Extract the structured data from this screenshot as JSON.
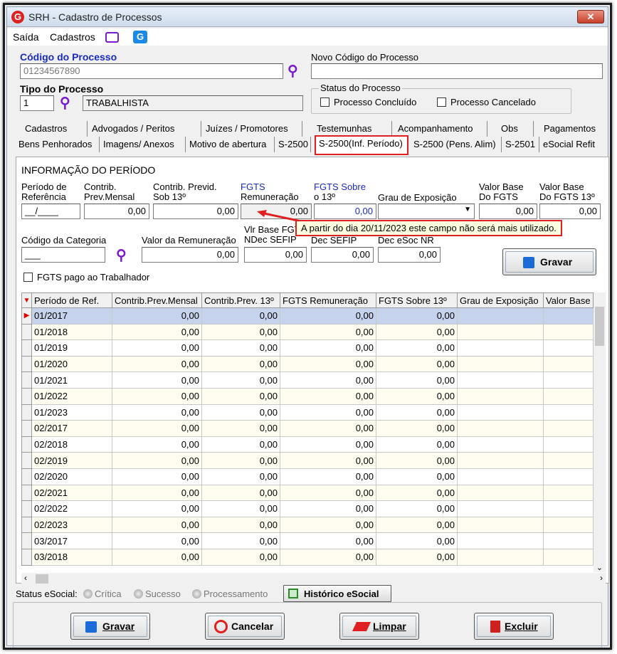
{
  "window": {
    "title": "SRH - Cadastro de Processos",
    "close": "✕"
  },
  "menu": {
    "items": [
      "Saída",
      "Cadastros"
    ]
  },
  "form": {
    "codigo_label": "Código do Processo",
    "codigo_value": "01234567890",
    "novo_codigo_label": "Novo Código do Processo",
    "novo_codigo_value": "",
    "tipo_label": "Tipo do Processo",
    "tipo_code": "1",
    "tipo_value": "TRABALHISTA",
    "status_group": "Status do Processo",
    "concluido": "Processo Concluído",
    "cancelado": "Processo Cancelado"
  },
  "tabs_row1": [
    "Cadastros",
    "Advogados / Peritos",
    "Juízes / Promotores",
    "Testemunhas",
    "Acompanhamento",
    "Obs",
    "Pagamentos"
  ],
  "tabs_row2": [
    "Bens Penhorados",
    "Imagens/ Anexos",
    "Motivo de abertura",
    "S-2500",
    "S-2500(Inf. Período)",
    "S-2500 (Pens. Alim)",
    "S-2501",
    "eSocial Refit"
  ],
  "panel": {
    "title": "INFORMAÇÃO DO PERÍODO",
    "f_periodo_l1": "Período de",
    "f_periodo_l2": "Referência",
    "f_periodo_v": "__/____",
    "f_contrib_l1": "Contrib.",
    "f_contrib_l2": "Prev.Mensal",
    "f_contrib_v": "0,00",
    "f_contrib13_l1": "Contrib. Previd.",
    "f_contrib13_l2": "Sob 13º",
    "f_contrib13_v": "0,00",
    "f_fgts_l1": "FGTS",
    "f_fgts_l2": "Remuneração",
    "f_fgts_v": "0,00",
    "f_fgts13_l1": "FGTS Sobre",
    "f_fgts13_l2": "o 13º",
    "f_fgts13_v": "0,00",
    "f_grau_l": "Grau de Exposição",
    "f_grau_v": "",
    "f_vbase_l1": "Valor Base",
    "f_vbase_l2": "Do FGTS",
    "f_vbase_v": "0,00",
    "f_vbase13_l1": "Valor Base",
    "f_vbase13_l2": "Do FGTS 13º",
    "f_vbase13_v": "0,00",
    "f_cat_l": "Código da Categoria",
    "f_cat_v": "___",
    "f_rem_l": "Valor da Remuneração",
    "f_rem_v": "0,00",
    "f_vlrb_l1": "Vlr Base FGT",
    "f_vlrb_l2": "NDec SEFIP",
    "f_vlrb_v": "0,00",
    "f_dec_l": "Dec SEFIP",
    "f_dec_v": "0,00",
    "f_decnr_l": "Dec eSoc NR",
    "f_decnr_v": "0,00",
    "fgts_pago": "FGTS pago ao Trabalhador",
    "gravar": "Gravar",
    "tooltip": "A partir do dia 20/11/2023 este campo não será mais utilizado."
  },
  "grid": {
    "columns": [
      "Período de Ref.",
      "Contrib.Prev.Mensal",
      "Contrib.Prev. 13º",
      "FGTS Remuneração",
      "FGTS Sobre 13º",
      "Grau de Exposição",
      "Valor Base"
    ],
    "rows": [
      [
        "01/2017",
        "0,00",
        "0,00",
        "0,00",
        "0,00"
      ],
      [
        "01/2018",
        "0,00",
        "0,00",
        "0,00",
        "0,00"
      ],
      [
        "01/2019",
        "0,00",
        "0,00",
        "0,00",
        "0,00"
      ],
      [
        "01/2020",
        "0,00",
        "0,00",
        "0,00",
        "0,00"
      ],
      [
        "01/2021",
        "0,00",
        "0,00",
        "0,00",
        "0,00"
      ],
      [
        "01/2022",
        "0,00",
        "0,00",
        "0,00",
        "0,00"
      ],
      [
        "01/2023",
        "0,00",
        "0,00",
        "0,00",
        "0,00"
      ],
      [
        "02/2017",
        "0,00",
        "0,00",
        "0,00",
        "0,00"
      ],
      [
        "02/2018",
        "0,00",
        "0,00",
        "0,00",
        "0,00"
      ],
      [
        "02/2019",
        "0,00",
        "0,00",
        "0,00",
        "0,00"
      ],
      [
        "02/2020",
        "0,00",
        "0,00",
        "0,00",
        "0,00"
      ],
      [
        "02/2021",
        "0,00",
        "0,00",
        "0,00",
        "0,00"
      ],
      [
        "02/2022",
        "0,00",
        "0,00",
        "0,00",
        "0,00"
      ],
      [
        "02/2023",
        "0,00",
        "0,00",
        "0,00",
        "0,00"
      ],
      [
        "03/2017",
        "0,00",
        "0,00",
        "0,00",
        "0,00"
      ],
      [
        "03/2018",
        "0,00",
        "0,00",
        "0,00",
        "0,00"
      ]
    ]
  },
  "status": {
    "label": "Status eSocial:",
    "critica": "Crítica",
    "sucesso": "Sucesso",
    "processamento": "Processamento",
    "historico": "Histórico eSocial"
  },
  "footer": {
    "gravar": "Gravar",
    "cancelar": "Cancelar",
    "limpar": "Limpar",
    "excluir": "Excluir"
  }
}
